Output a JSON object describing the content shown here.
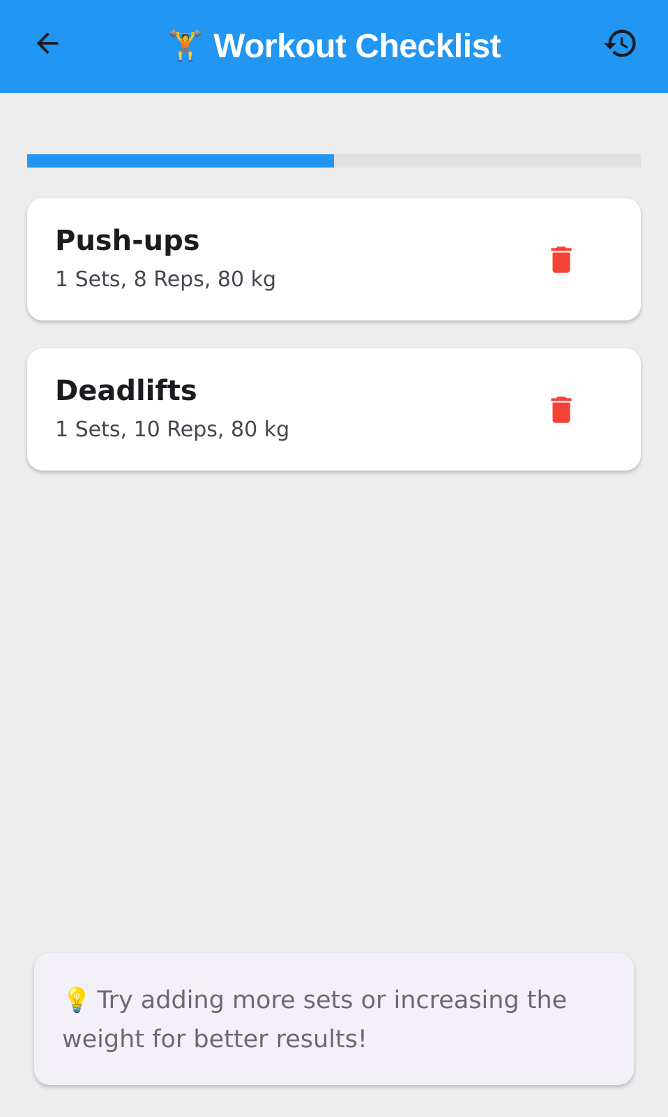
{
  "appbar": {
    "title": "Workout Checklist",
    "title_emoji": "🏋️",
    "back_icon": "arrow-left-icon",
    "history_icon": "history-icon",
    "color": "#2196f3"
  },
  "progress": {
    "fraction": 0.5,
    "fill_color": "#2196f3",
    "track_color": "#e0e0e0"
  },
  "exercises": [
    {
      "name": "Push-ups",
      "detail": "1 Sets, 8 Reps, 80 kg",
      "delete_icon": "trash-icon"
    },
    {
      "name": "Deadlifts",
      "detail": "1 Sets, 10 Reps, 80 kg",
      "delete_icon": "trash-icon"
    }
  ],
  "tip": {
    "emoji": "💡",
    "text": "Try adding more sets or increasing the weight for better results!"
  },
  "colors": {
    "delete": "#f44336",
    "background": "#ededed"
  }
}
